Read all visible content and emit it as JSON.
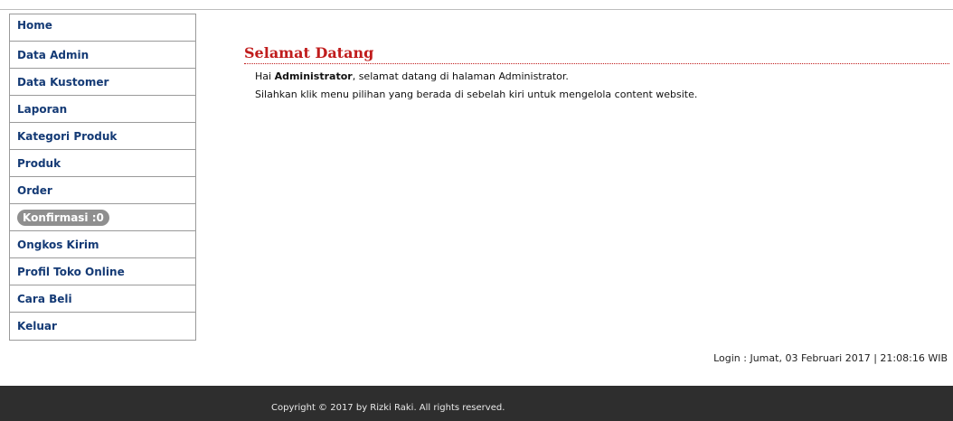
{
  "sidebar": {
    "items": [
      {
        "label": "Home"
      },
      {
        "label": "Data Admin"
      },
      {
        "label": "Data Kustomer"
      },
      {
        "label": "Laporan"
      },
      {
        "label": "Kategori Produk"
      },
      {
        "label": "Produk"
      },
      {
        "label": "Order"
      },
      {
        "label": "Konfirmasi :0"
      },
      {
        "label": "Ongkos Kirim"
      },
      {
        "label": "Profil Toko Online"
      },
      {
        "label": "Cara Beli"
      },
      {
        "label": "Keluar"
      }
    ]
  },
  "main": {
    "title": "Selamat Datang",
    "greeting_prefix": "Hai ",
    "greeting_user": "Administrator",
    "greeting_suffix": ", selamat datang di halaman Administrator.",
    "instruction": "Silahkan klik menu pilihan yang berada di sebelah kiri untuk mengelola content website."
  },
  "status": {
    "login_info": "Login : Jumat, 03 Februari 2017 | 21:08:16 WIB"
  },
  "footer": {
    "copyright": "Copyright © 2017 by Rizki Raki. All rights reserved."
  },
  "colors": {
    "menu_text": "#143a75",
    "title_red": "#c01c1c",
    "footer_bg": "#2e2e2e",
    "badge_bg": "#8f8f8f"
  }
}
